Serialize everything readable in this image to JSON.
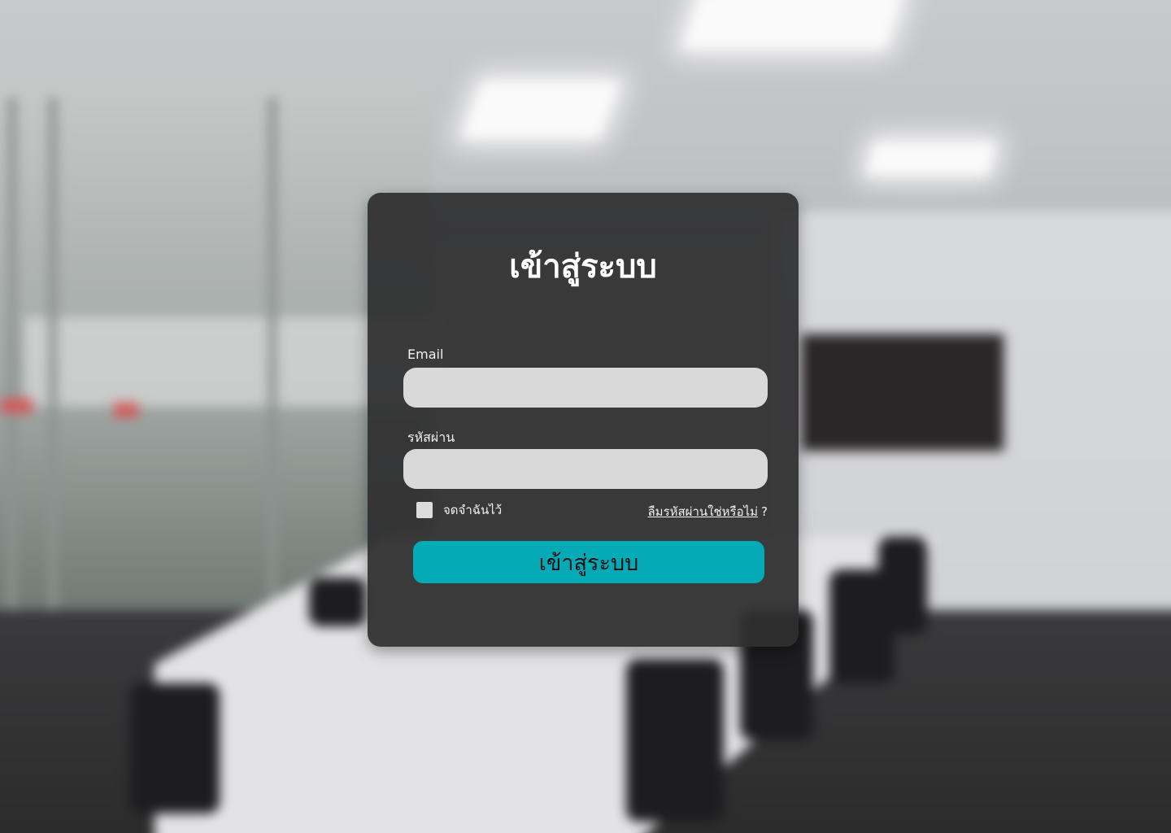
{
  "login": {
    "title": "เข้าสู่ระบบ",
    "email_label": "Email",
    "email_value": "",
    "password_label": "รหัสผ่าน",
    "password_value": "",
    "remember_label": "จดจำฉันไว้",
    "remember_checked": false,
    "forgot_link": "ลืมรหัสผ่านใช่หรือไม่",
    "forgot_suffix": "?",
    "submit_label": "เข้าสู่ระบบ"
  },
  "colors": {
    "card": "#2e2e2f",
    "input": "#d9d9d9",
    "accent": "#04aab5"
  }
}
